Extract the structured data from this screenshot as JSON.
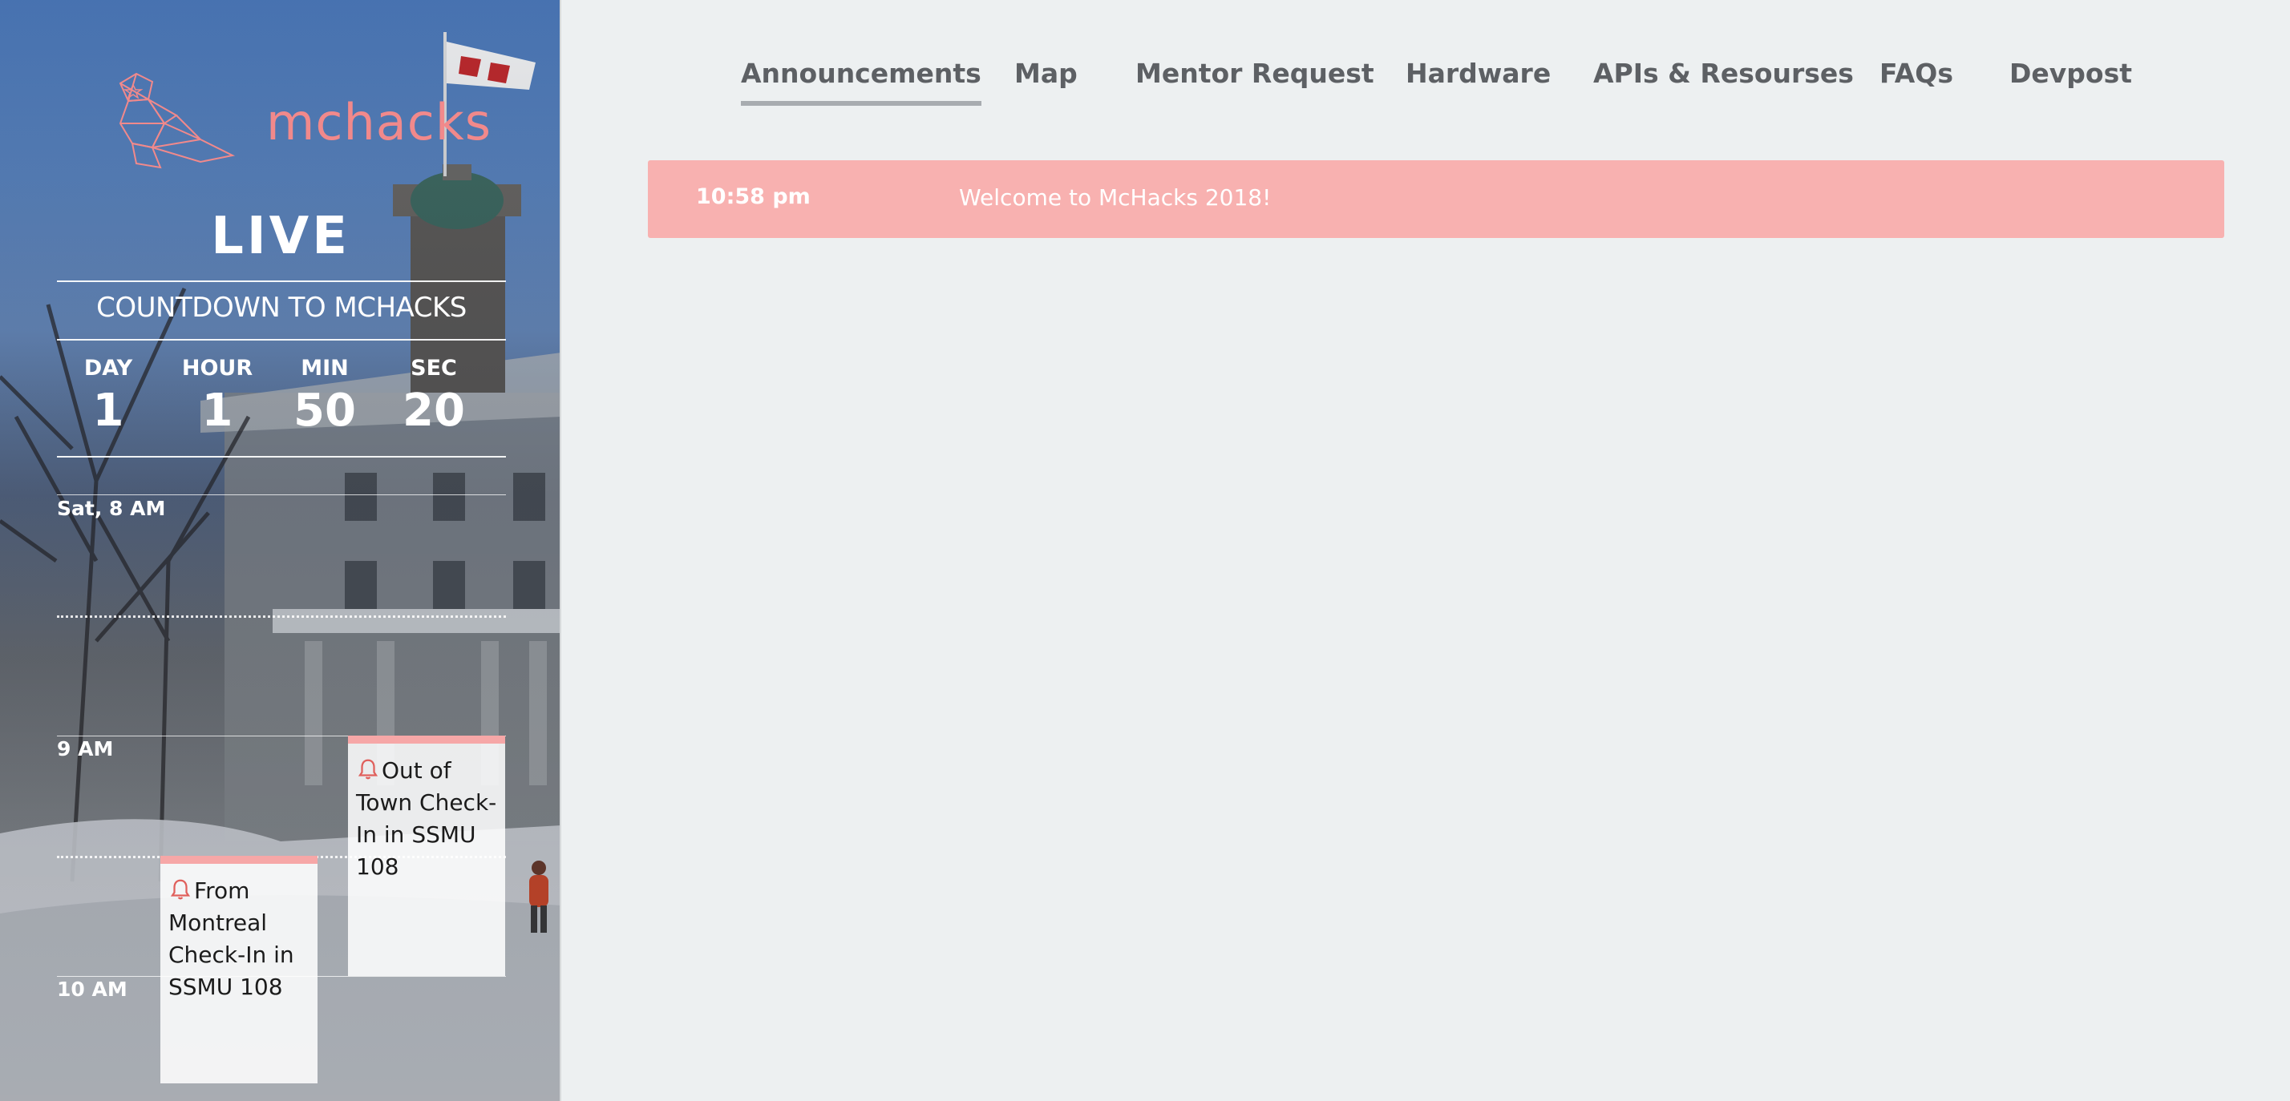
{
  "sidebar": {
    "logo_text": "mchacks",
    "live_label": "LIVE",
    "countdown_title": "COUNTDOWN TO MCHACKS",
    "countdown": [
      {
        "label": "DAY",
        "value": "1"
      },
      {
        "label": "HOUR",
        "value": "1"
      },
      {
        "label": "MIN",
        "value": "50"
      },
      {
        "label": "SEC",
        "value": "20"
      }
    ],
    "schedule": {
      "time_labels": [
        "Sat, 8 AM",
        "9 AM",
        "10 AM"
      ],
      "events": [
        {
          "title": "Out of Town Check-In in SSMU 108",
          "icon": "bell-icon"
        },
        {
          "title": "From Montreal Check-In in SSMU 108",
          "icon": "bell-icon"
        }
      ]
    },
    "colors": {
      "accent": "#f1898b",
      "card_top": "#f6a7a7"
    }
  },
  "nav": {
    "items": [
      {
        "label": "Announcements",
        "active": true
      },
      {
        "label": "Map"
      },
      {
        "label": "Mentor Request"
      },
      {
        "label": "Hardware"
      },
      {
        "label": "APIs & Resourses"
      },
      {
        "label": "FAQs"
      },
      {
        "label": "Devpost"
      }
    ]
  },
  "announcements": [
    {
      "time": "10:58 pm",
      "text": "Welcome to McHacks 2018!"
    }
  ],
  "colors": {
    "background": "#edf0f1",
    "announcement_bg": "#f8b1b0",
    "nav_text": "#5d6064"
  }
}
